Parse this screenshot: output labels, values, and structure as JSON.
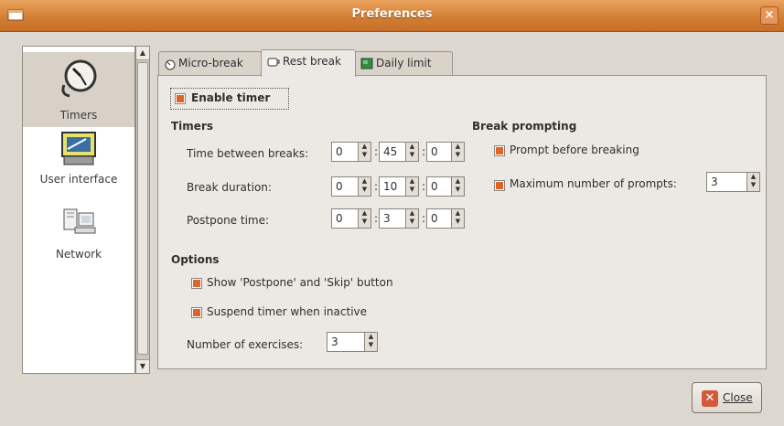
{
  "window": {
    "title": "Preferences",
    "close_glyph": "×"
  },
  "sidebar": {
    "items": [
      {
        "label": "Timers",
        "icon": "clock-icon",
        "selected": true
      },
      {
        "label": "User interface",
        "icon": "monitor-icon",
        "selected": false
      },
      {
        "label": "Network",
        "icon": "network-icon",
        "selected": false
      }
    ]
  },
  "tabs": [
    {
      "label": "Micro-break",
      "active": false
    },
    {
      "label": "Rest break",
      "active": true
    },
    {
      "label": "Daily limit",
      "active": false
    }
  ],
  "rest_break": {
    "enable_timer": {
      "label": "Enable timer",
      "checked": true
    },
    "timers_heading": "Timers",
    "time_between_breaks": {
      "label": "Time between breaks:",
      "hours": "0",
      "minutes": "45",
      "seconds": "0"
    },
    "break_duration": {
      "label": "Break duration:",
      "hours": "0",
      "minutes": "10",
      "seconds": "0"
    },
    "postpone_time": {
      "label": "Postpone time:",
      "hours": "0",
      "minutes": "3",
      "seconds": "0"
    },
    "colon": ":",
    "options_heading": "Options",
    "show_postpone_skip": {
      "label": "Show 'Postpone' and 'Skip' button",
      "checked": true
    },
    "suspend_inactive": {
      "label": "Suspend timer when inactive",
      "checked": true
    },
    "number_of_exercises": {
      "label": "Number of exercises:",
      "value": "3"
    },
    "break_prompting_heading": "Break prompting",
    "prompt_before_breaking": {
      "label": "Prompt before breaking",
      "checked": true
    },
    "max_prompts": {
      "label": "Maximum number of prompts:",
      "value": "3",
      "checked": true
    }
  },
  "footer": {
    "close_label": "Close"
  },
  "colors": {
    "titlebar": "#d27c33",
    "checkbox_mark": "#e0642a",
    "window_bg": "#ddd8cf",
    "panel_bg": "#ece9e4"
  }
}
